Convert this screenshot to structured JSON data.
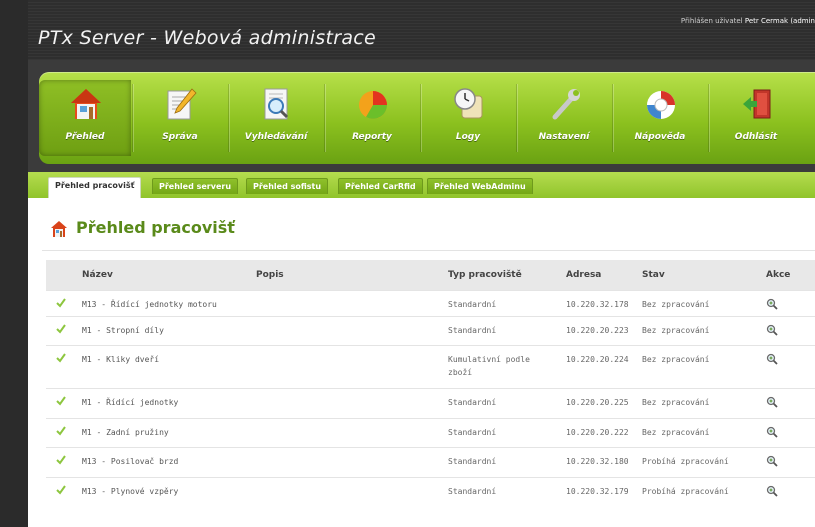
{
  "header": {
    "app_title": "PTx Server - Webová administrace",
    "user_prefix": "Přihlášen uživatel",
    "user_name": "Petr Cermak (admin"
  },
  "nav": [
    {
      "label": "Přehled",
      "icon": "home-icon",
      "active": true
    },
    {
      "label": "Správa",
      "icon": "edit-document-icon"
    },
    {
      "label": "Vyhledávání",
      "icon": "search-document-icon"
    },
    {
      "label": "Reporty",
      "icon": "pie-chart-icon"
    },
    {
      "label": "Logy",
      "icon": "clock-scroll-icon"
    },
    {
      "label": "Nastavení",
      "icon": "wrench-icon"
    },
    {
      "label": "Nápověda",
      "icon": "help-icon"
    },
    {
      "label": "Odhlásit",
      "icon": "logout-door-icon"
    }
  ],
  "subtabs": [
    {
      "label": "Přehled pracovišť",
      "active": true
    },
    {
      "label": "Přehled serveru"
    },
    {
      "label": "Přehled sofistu"
    },
    {
      "label": "Přehled CarRfid"
    },
    {
      "label": "Přehled WebAdminu"
    }
  ],
  "page": {
    "title": "Přehled pracovišť"
  },
  "table": {
    "columns": [
      "Název",
      "Popis",
      "Typ pracoviště",
      "Adresa",
      "Stav",
      "Akce"
    ],
    "rows": [
      {
        "name": "M13 - Řídící jednotky motoru",
        "popis": "",
        "type": "Standardní",
        "type2": "",
        "address": "10.220.32.178",
        "status": "Bez zpracování"
      },
      {
        "name": "M1 - Stropní díly",
        "popis": "",
        "type": "Standardní",
        "type2": "",
        "address": "10.220.20.223",
        "status": "Bez zpracování"
      },
      {
        "name": "M1 - Kliky dveří",
        "popis": "",
        "type": "Kumulativní podle",
        "type2": "zboží",
        "address": "10.220.20.224",
        "status": "Bez zpracování"
      },
      {
        "name": "M1 - Řídící jednotky",
        "popis": "",
        "type": "Standardní",
        "type2": "",
        "address": "10.220.20.225",
        "status": "Bez zpracování"
      },
      {
        "name": "M1 - Zadní pružiny",
        "popis": "",
        "type": "Standardní",
        "type2": "",
        "address": "10.220.20.222",
        "status": "Bez zpracování"
      },
      {
        "name": "M13 - Posilovač brzd",
        "popis": "",
        "type": "Standardní",
        "type2": "",
        "address": "10.220.32.180",
        "status": "Probíhá zpracování"
      },
      {
        "name": "M13 - Plynové vzpěry",
        "popis": "",
        "type": "Standardní",
        "type2": "",
        "address": "10.220.32.179",
        "status": "Probíhá zpracování"
      }
    ]
  },
  "colors": {
    "accent_green": "#8cc11f",
    "heading_green": "#5a8a1a",
    "check_green": "#8dc63f"
  }
}
